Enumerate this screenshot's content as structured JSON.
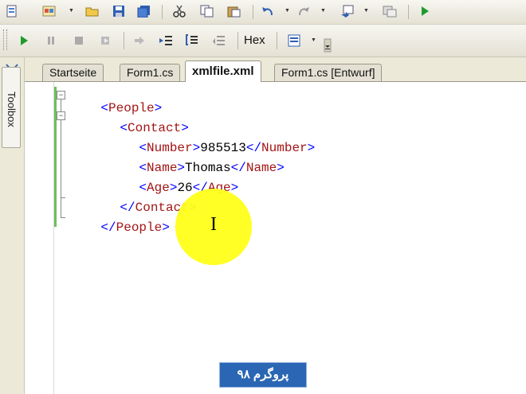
{
  "toolbar2": {
    "hex_label": "Hex"
  },
  "toolbox": {
    "label": "Toolbox"
  },
  "tabs": [
    {
      "label": "Startseite"
    },
    {
      "label": "Form1.cs"
    },
    {
      "label": "xmlfile.xml",
      "active": true
    },
    {
      "label": "Form1.cs [Entwurf]"
    }
  ],
  "code": {
    "l1_tag": "People",
    "l2_tag": "Contact",
    "l3_tag": "Number",
    "l3_value": "985513",
    "l4_tag": "Name",
    "l4_value": "Thomas",
    "l5_tag": "Age",
    "l5_value": "26",
    "l6_tag": "Contact",
    "l7_tag": "People"
  },
  "symbols": {
    "lt": "<",
    "gt": ">",
    "lt_slash": "</",
    "fold_minus": "−"
  },
  "watermark": {
    "text": "پروگرم ۹۸"
  },
  "colors": {
    "bracket": "#0000ff",
    "tag": "#a31515",
    "highlight": "#ffff1a",
    "changebar": "#6cc05c",
    "watermark_bg": "#2a66b3"
  },
  "icons": [
    "new-project-icon",
    "add-item-icon",
    "open-file-icon",
    "save-icon",
    "save-all-icon",
    "cut-icon",
    "copy-icon",
    "paste-icon",
    "undo-icon",
    "redo-icon",
    "navigate-icon",
    "step-icon",
    "start-debug-icon",
    "pause-icon",
    "stop-icon",
    "restart-icon",
    "show-next-statement-icon",
    "step-into-icon",
    "step-over-icon",
    "step-out-icon",
    "hex-toggle",
    "format-icon",
    "toolbar-options-icon",
    "text-cursor-icon"
  ]
}
